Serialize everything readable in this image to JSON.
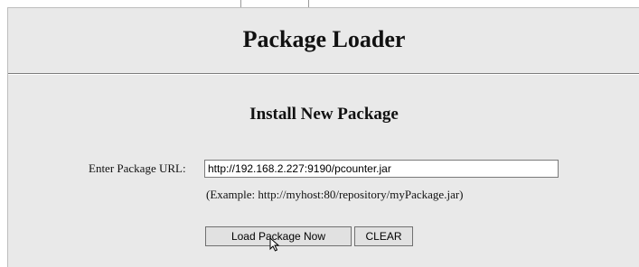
{
  "page": {
    "title": "Package Loader",
    "subtitle": "Install New Package"
  },
  "form": {
    "url_label": "Enter Package URL:",
    "url_value": "http://192.168.2.227:9190/pcounter.jar",
    "example_text": "(Example: http://myhost:80/repository/myPackage.jar)",
    "load_button_label": "Load Package Now",
    "clear_button_label": "CLEAR"
  },
  "colors": {
    "panel_background": "#e9e9e9",
    "button_background": "#e1e1e1",
    "rule": "#7d7d7d"
  },
  "icons": {
    "cursor": "mouse-pointer-icon"
  }
}
